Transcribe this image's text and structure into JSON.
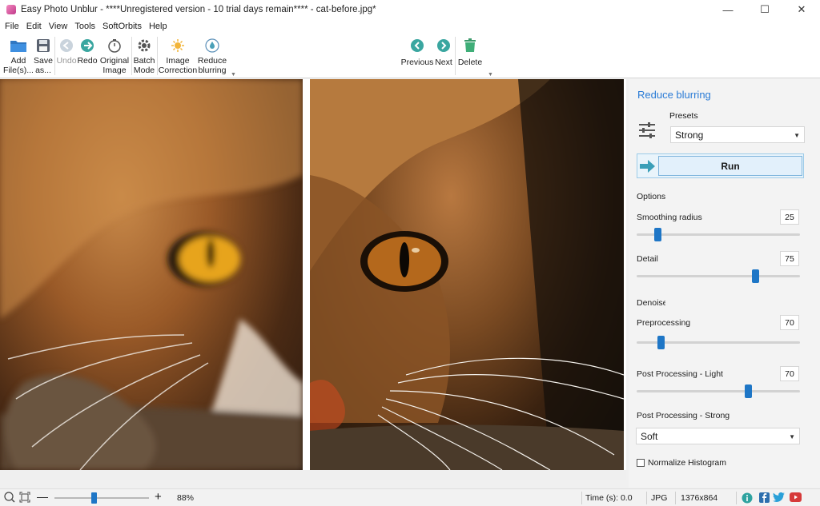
{
  "window": {
    "title": "Easy Photo Unblur - ****Unregistered version - 10 trial days remain**** - cat-before.jpg*",
    "minimize": "—",
    "maximize": "☐",
    "close": "✕"
  },
  "menu": [
    "File",
    "Edit",
    "View",
    "Tools",
    "SoftOrbits",
    "Help"
  ],
  "toolbar": {
    "add_files": "Add\nFile(s)...",
    "save_as": "Save\nas...",
    "undo": "Undo",
    "redo": "Redo",
    "original_image": "Original\nImage",
    "batch_mode": "Batch\nMode",
    "image_correction": "Image\nCorrection",
    "reduce_blurring": "Reduce\nblurring",
    "previous": "Previous",
    "next": "Next",
    "delete": "Delete"
  },
  "panel": {
    "title": "Reduce blurring",
    "presets_label": "Presets",
    "preset_value": "Strong",
    "run_label": "Run",
    "options_label": "Options",
    "smoothing_label": "Smoothing radius",
    "smoothing_value": "25",
    "detail_label": "Detail",
    "detail_value": "75",
    "denoise_label": "Denoise",
    "preprocessing_label": "Preprocessing",
    "preprocessing_value": "70",
    "post_light_label": "Post Processing - Light",
    "post_light_value": "70",
    "post_strong_label": "Post Processing - Strong",
    "post_strong_value": "Soft",
    "normalize_label": "Normalize Histogram"
  },
  "status": {
    "zoom": "88%",
    "zoom_minus": "—",
    "zoom_plus": "+",
    "time": "Time (s): 0.0",
    "format": "JPG",
    "dimensions": "1376x864"
  },
  "colors": {
    "accent": "#2a7bd6",
    "slider": "#1e76c6"
  }
}
